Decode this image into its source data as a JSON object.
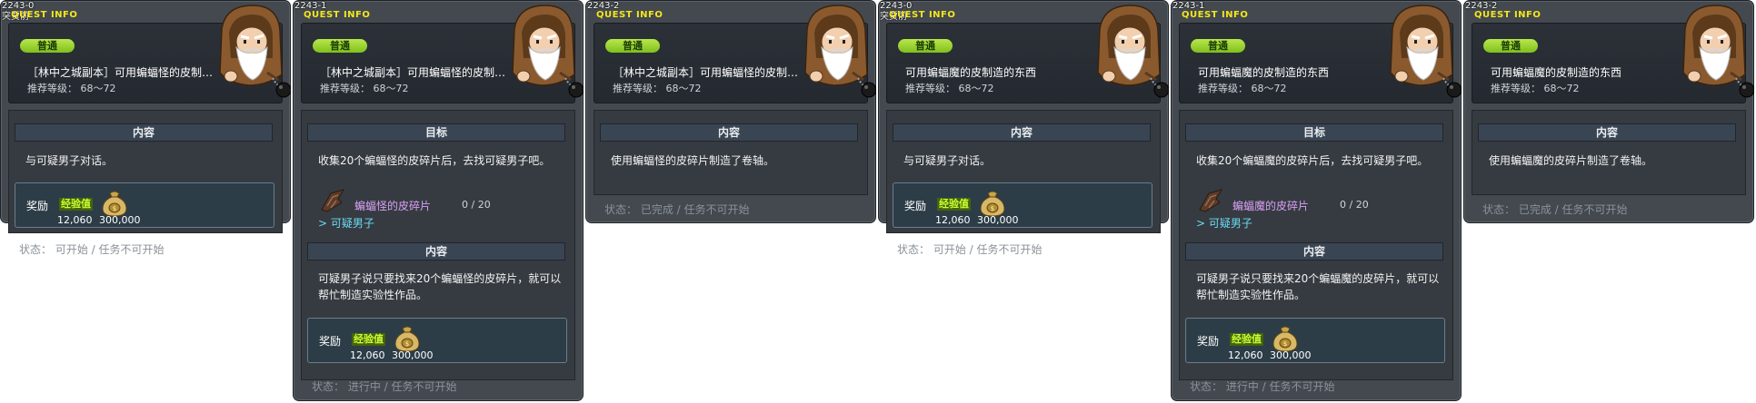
{
  "common": {
    "quest_info_label": "QUEST INFO",
    "badge": "普通",
    "level": "推荐等级： 68～72",
    "reward_label": "奖励",
    "exp_label": "经验值",
    "exp_value": "12,060",
    "mesos_value": "300,000",
    "content_header": "内容",
    "goal_header": "目标",
    "npc_name": "可疑男子",
    "npc_icon": "old-hooded-man-npc",
    "mesos_icon": "money-bag-icon",
    "item_icon": "leather-fragment-icon"
  },
  "panels": [
    {
      "quest_id": "2243-0",
      "sub_label": "突贾前",
      "title": "［林中之城副本］可用蝙蝠怪的皮制…",
      "content_text": "与可疑男子对话。",
      "status": "状态：  可开始  /  任务不可开始"
    },
    {
      "quest_id": "2243-1",
      "title": "［林中之城副本］可用蝙蝠怪的皮制…",
      "goal_text": "收集20个蝙蝠怪的皮碎片后，去找可疑男子吧。",
      "item_name": "蝙蝠怪的皮碎片",
      "item_count": "0 / 20",
      "npc_link": "> 可疑男子",
      "content_text": "可疑男子说只要找来20个蝙蝠怪的皮碎片，就可以帮忙制造实验性作品。",
      "status": "状态：  进行中  /  任务不可开始"
    },
    {
      "quest_id": "2243-2",
      "title": "［林中之城副本］可用蝙蝠怪的皮制…",
      "content_text": "使用蝙蝠怪的皮碎片制造了卷轴。",
      "status": "状态：  已完成  /  任务不可开始"
    },
    {
      "quest_id": "2243-0",
      "sub_label": "突贾前",
      "title": "可用蝙蝠魔的皮制造的东西",
      "content_text": "与可疑男子对话。",
      "status": "状态：  可开始  /  任务不可开始"
    },
    {
      "quest_id": "2243-1",
      "title": "可用蝙蝠魔的皮制造的东西",
      "goal_text": "收集20个蝙蝠魔的皮碎片后，去找可疑男子吧。",
      "item_name": "蝙蝠魔的皮碎片",
      "item_count": "0 / 20",
      "npc_link": "> 可疑男子",
      "content_text": "可疑男子说只要找来20个蝙蝠魔的皮碎片，就可以帮忙制造实验性作品。",
      "status": "状态：  进行中  /  任务不可开始"
    },
    {
      "quest_id": "2243-2",
      "title": "可用蝙蝠魔的皮制造的东西",
      "content_text": "使用蝙蝠魔的皮碎片制造了卷轴。",
      "status": "状态：  已完成  /  任务不可开始"
    }
  ]
}
